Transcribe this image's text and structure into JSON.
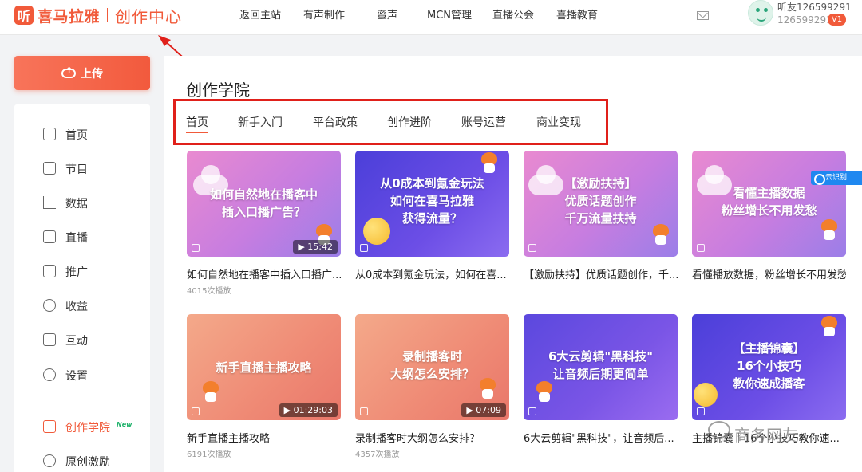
{
  "header": {
    "logo_mark": "听",
    "brand": "喜马拉雅",
    "sub": "创作中心",
    "nav": [
      "返回主站",
      "有声制作",
      "蜜声",
      "MCN管理",
      "直播公会",
      "喜播教育"
    ],
    "user_name": "听友126599291",
    "user_id": "126599291",
    "vip": "V1"
  },
  "sidebar": {
    "upload": "上传",
    "items": [
      {
        "label": "首页",
        "icon": "home-icon"
      },
      {
        "label": "节目",
        "icon": "radio-icon"
      },
      {
        "label": "数据",
        "icon": "chart-icon"
      },
      {
        "label": "直播",
        "icon": "tv-icon"
      },
      {
        "label": "推广",
        "icon": "speaker-icon"
      },
      {
        "label": "收益",
        "icon": "yen-icon"
      },
      {
        "label": "互动",
        "icon": "chat-icon"
      },
      {
        "label": "设置",
        "icon": "gear-icon"
      },
      {
        "label": "创作学院",
        "icon": "graduation-cap-icon",
        "badge": "New",
        "active": true
      },
      {
        "label": "原创激励",
        "icon": "medal-icon"
      }
    ]
  },
  "main": {
    "title": "创作学院",
    "tabs": [
      "首页",
      "新手入门",
      "平台政策",
      "创作进阶",
      "账号运营",
      "商业变现"
    ],
    "cards": [
      {
        "thumb_text": "如何自然地在播客中\n插入口播广告？",
        "duration": "15:42",
        "title": "如何自然地在播客中插入口播广...",
        "plays": "4015次播放"
      },
      {
        "thumb_text": "从0成本到氪金玩法\n如何在喜马拉雅\n获得流量？",
        "duration": "",
        "title": "从0成本到氪金玩法，如何在喜...",
        "plays": ""
      },
      {
        "thumb_text": "【激励扶持】\n优质话题创作\n千万流量扶持",
        "duration": "",
        "title": "【激励扶持】优质话题创作，千...",
        "plays": ""
      },
      {
        "thumb_text": "看懂主播数据\n粉丝增长不用发愁",
        "duration": "",
        "title": "看懂播放数据，粉丝增长不用发愁",
        "plays": ""
      },
      {
        "thumb_text": "新手直播主播攻略",
        "duration": "01:29:03",
        "title": "新手直播主播攻略",
        "plays": "6191次播放"
      },
      {
        "thumb_text": "录制播客时\n大纲怎么安排？",
        "duration": "07:09",
        "title": "录制播客时大纲怎么安排？",
        "plays": "4357次播放"
      },
      {
        "thumb_text": "6大云剪辑\"黑科技\"\n让音频后期更简单",
        "duration": "",
        "title": "6大云剪辑\"黑科技\"，让音频后...",
        "plays": ""
      },
      {
        "thumb_text": "【主播锦囊】\n16个小技巧\n教你速成播客",
        "duration": "",
        "title": "主播锦囊｜16个小技巧教你速...",
        "plays": ""
      }
    ]
  },
  "overlay": {
    "float_tag": "云识别",
    "watermark": "商务网友"
  },
  "colors": {
    "accent": "#f15a3a",
    "annotation": "#e0201a"
  }
}
